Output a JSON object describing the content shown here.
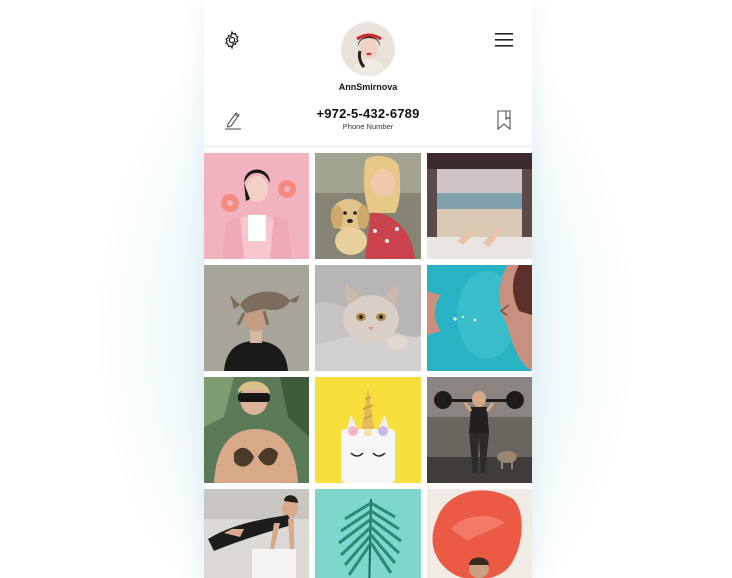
{
  "profile": {
    "username": "AnnSmirnova",
    "phone_number": "+972-5-432-6789",
    "phone_label": "Phone Number"
  },
  "icons": {
    "settings": "gear-icon",
    "menu": "hamburger-menu-icon",
    "edit": "pencil-icon",
    "saved": "bookmark-icon"
  },
  "colors": {
    "background": "#ffffff",
    "text": "#111111",
    "page_glow": "#d6eef4"
  },
  "photos": [
    {
      "subject": "woman with pink donuts on pink background",
      "bg": "#f1b3bd"
    },
    {
      "subject": "girl hugging golden retriever puppy",
      "bg": "#8a8a78"
    },
    {
      "subject": "feet out of van door at beach",
      "bg": "#c9bfb8"
    },
    {
      "subject": "sphynx cat on person's head",
      "bg": "#9a968c"
    },
    {
      "subject": "kitten in grey blanket",
      "bg": "#c8c6c4"
    },
    {
      "subject": "woman underwater in turquoise pool",
      "bg": "#29b4c4"
    },
    {
      "subject": "woman with sunglasses in bikini near palms",
      "bg": "#5b7a57"
    },
    {
      "subject": "unicorn cake on yellow background",
      "bg": "#f6de3c"
    },
    {
      "subject": "woman lifting barbell in gym with dog",
      "bg": "#5a5652"
    },
    {
      "subject": "woman doing push up exercise",
      "bg": "#d9d6d1"
    },
    {
      "subject": "palm leaf on mint background",
      "bg": "#7fd6cc"
    },
    {
      "subject": "woman in flowing red fabric",
      "bg": "#f2ece6"
    }
  ]
}
